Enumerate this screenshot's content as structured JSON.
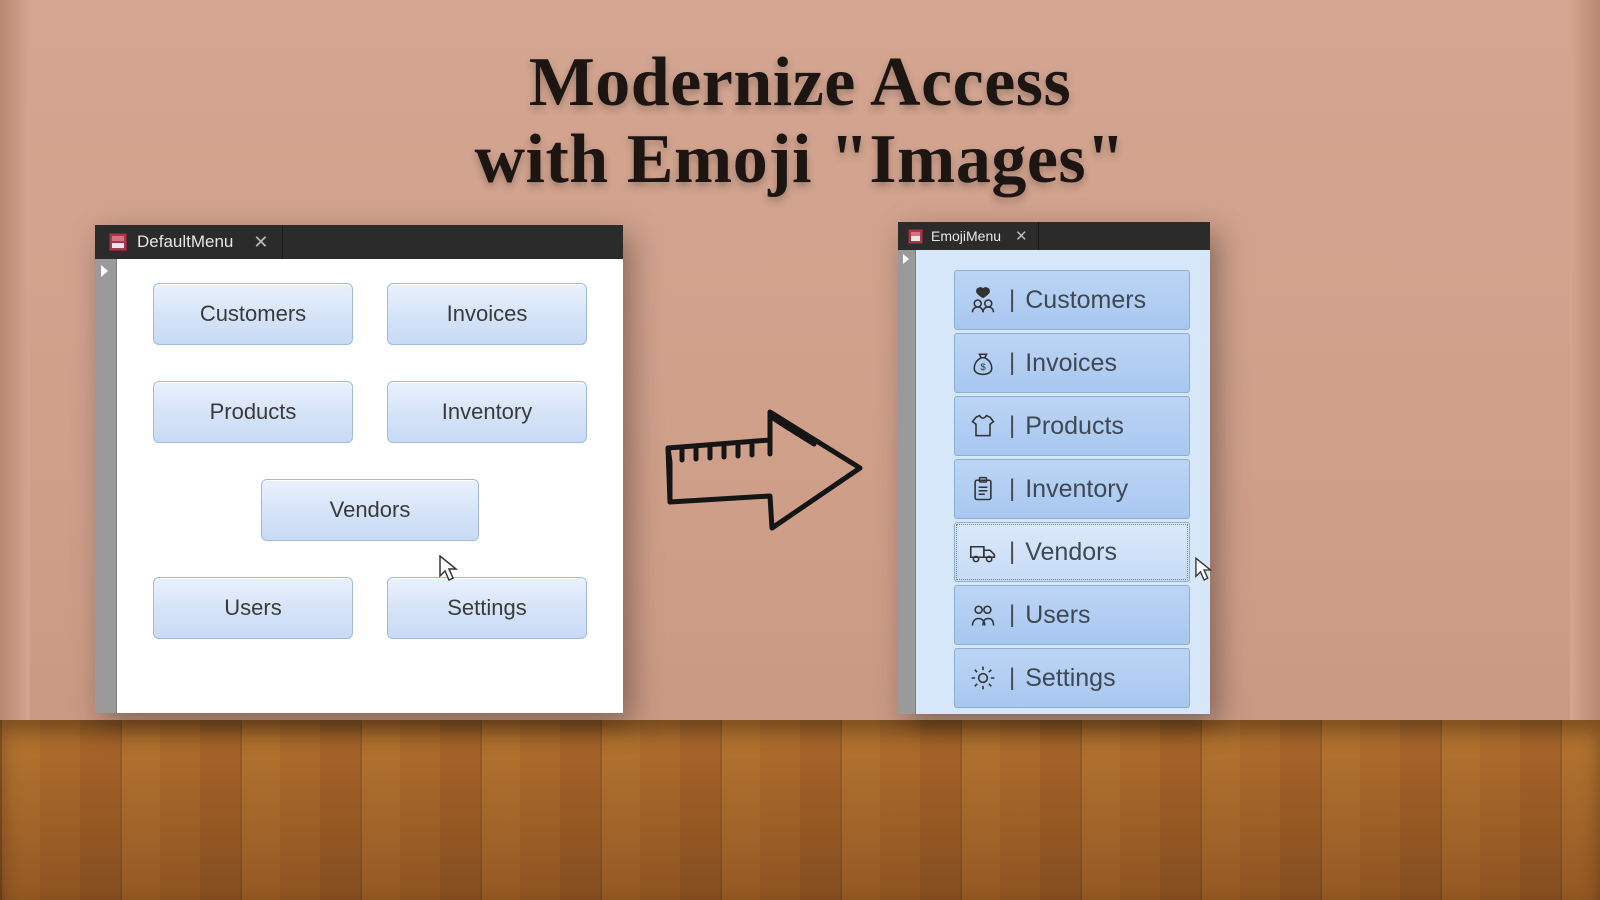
{
  "headline": {
    "line1": "Modernize Access",
    "line2": "with Emoji \"Images\""
  },
  "windows": {
    "default": {
      "title": "DefaultMenu",
      "buttons": {
        "customers": "Customers",
        "invoices": "Invoices",
        "products": "Products",
        "inventory": "Inventory",
        "vendors": "Vendors",
        "users": "Users",
        "settings": "Settings"
      }
    },
    "emoji": {
      "title": "EmojiMenu",
      "separator": "|",
      "items": [
        {
          "icon": "couple-heart-icon",
          "label": "Customers"
        },
        {
          "icon": "money-bag-icon",
          "label": "Invoices"
        },
        {
          "icon": "tshirt-icon",
          "label": "Products"
        },
        {
          "icon": "clipboard-icon",
          "label": "Inventory"
        },
        {
          "icon": "truck-icon",
          "label": "Vendors",
          "hover": true
        },
        {
          "icon": "people-icon",
          "label": "Users"
        },
        {
          "icon": "gear-icon",
          "label": "Settings"
        }
      ]
    }
  }
}
